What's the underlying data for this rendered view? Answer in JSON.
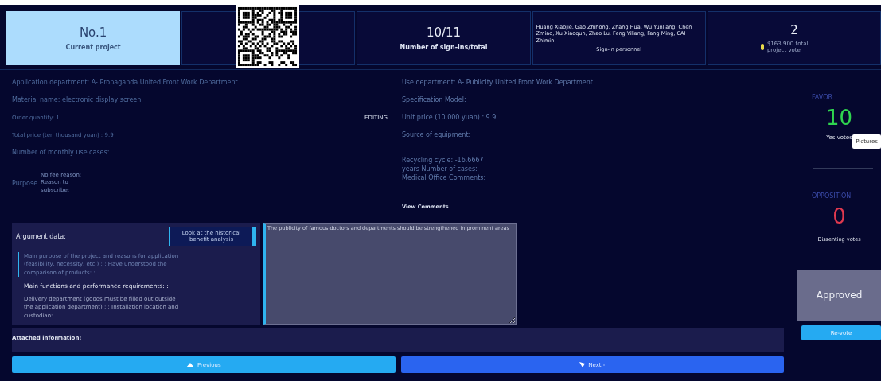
{
  "summary_cards": [
    {
      "kind": "stat",
      "value": "No.1",
      "label": "Current project",
      "selected": true
    },
    {
      "kind": "qr",
      "selected": false
    },
    {
      "kind": "stat",
      "value": "10/11",
      "label": "Number of sign-ins/total",
      "selected": false
    },
    {
      "kind": "names",
      "value": "Huang Xiaojie, Gao Zhihong, Zhang Hua, Wu Yunliang, Chen Zmiao, Xu Xiaoqun, Zhao Lu, Feng Yiliang, Fang Ming, CAI Zhimin",
      "label": "Sign-in personnel",
      "selected": false
    },
    {
      "kind": "vote",
      "value": "2",
      "label": "$163,900 total project vote",
      "selected": false
    }
  ],
  "left_fields": [
    {
      "kind": "normal",
      "text": "Application department: A- Propaganda United Front Work Department"
    },
    {
      "kind": "normal",
      "text": "Material name: electronic display screen"
    },
    {
      "kind": "small",
      "text": "Order quantity: 1",
      "action": "EDITING"
    },
    {
      "kind": "tiny",
      "text": "Total price (ten thousand yuan) : 9.9"
    },
    {
      "kind": "normal",
      "text": "Number of monthly use cases:"
    },
    {
      "kind": "purpose",
      "text": "Purpose",
      "note": "No fee reason: Reason to subscribe:"
    }
  ],
  "right_fields": [
    {
      "kind": "normal",
      "text": "Use department: A- Publicity United Front Work Department"
    },
    {
      "kind": "normal",
      "text": "Specification Model:"
    },
    {
      "kind": "normal",
      "text": "Unit price (10,000 yuan) : 9.9"
    },
    {
      "kind": "normal",
      "text": "Source of equipment:"
    },
    {
      "kind": "lines",
      "lines": [
        "Recycling cycle: -16.6667",
        "years Number of cases:",
        "Medical Office Comments:"
      ]
    }
  ],
  "view_comments": "View Comments",
  "argument": {
    "title": "Argument data:",
    "tab": "Look at the historical benefit analysis",
    "paragraphs": [
      {
        "kind": "muted",
        "text": "Main purpose of the project and reasons for application (feasibility, necessity, etc.) : : Have understood the comparison of products: :"
      },
      {
        "kind": "heading",
        "text": "Main functions and performance requirements: :"
      },
      {
        "kind": "body",
        "text": "Delivery department (goods must be filled out outside the application department) : : Installation location and custodian:"
      }
    ],
    "comment": "The publicity of famous doctors and departments should be strengthened in prominent areas"
  },
  "attached_label": "Attached information:",
  "buttons": [
    {
      "kind": "prev",
      "label": "Previous"
    },
    {
      "kind": "next",
      "label": "Next -"
    }
  ],
  "votes": {
    "favor_title": "FAVOR",
    "favor_count": "10",
    "favor_label": "Yes votes",
    "tooltip": "Pictures",
    "opposition_title": "OPPOSITION",
    "opposition_count": "0",
    "opposition_label": "Dissenting votes",
    "result": "Approved",
    "revote": "Re-vote"
  }
}
